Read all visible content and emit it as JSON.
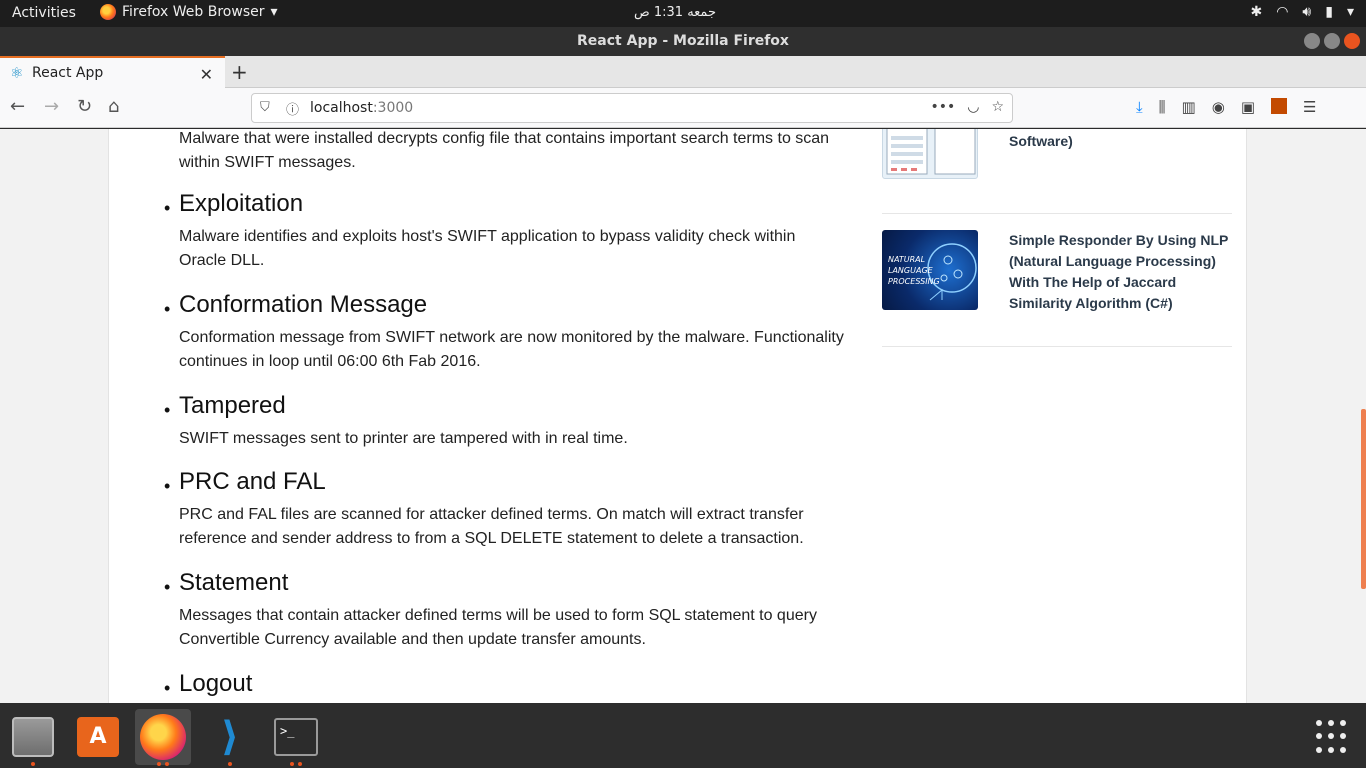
{
  "system": {
    "activities": "Activities",
    "app_menu": "Firefox Web Browser",
    "clock": "جمعه ‏1:31 ص"
  },
  "window": {
    "title": "React App - Mozilla Firefox"
  },
  "tabs": [
    {
      "label": "React App",
      "active": true
    }
  ],
  "address_bar": {
    "host": "localhost",
    "port": ":3000"
  },
  "article": {
    "intro": "Malware that were installed decrypts config file that contains important search terms to scan within SWIFT messages.",
    "items": [
      {
        "title": "Exploitation",
        "text": "Malware identifies and exploits host's SWIFT application to bypass validity check within Oracle DLL."
      },
      {
        "title": "Conformation Message",
        "text": "Conformation message from SWIFT network are now monitored by the malware. Functionality continues in loop until 06:00 6th Fab 2016."
      },
      {
        "title": "Tampered",
        "text": "SWIFT messages sent to printer are tampered with in real time."
      },
      {
        "title": "PRC and FAL",
        "text": "PRC and FAL files are scanned for attacker defined terms. On match will extract transfer reference and sender address to from a SQL DELETE statement to delete a transaction."
      },
      {
        "title": "Statement",
        "text": "Messages that contain attacker defined terms will be used to form SQL statement to query Convertible Currency available and then update transfer amounts."
      },
      {
        "title": "Logout",
        "text": ""
      }
    ]
  },
  "sidebar": {
    "cards": [
      {
        "title": "Create Cash Memo Application by Using Text file. (Billing Software)"
      },
      {
        "title": "Simple Responder By Using NLP (Natural Language Processing) With The Help of Jaccard Similarity Algorithm (C#)",
        "thumb_text": "NATURAL LANGUAGE PROCESSING"
      }
    ]
  },
  "colors": {
    "accent": "#e66e22",
    "download": "#0a84ff",
    "card_title": "#2b3a4a"
  }
}
